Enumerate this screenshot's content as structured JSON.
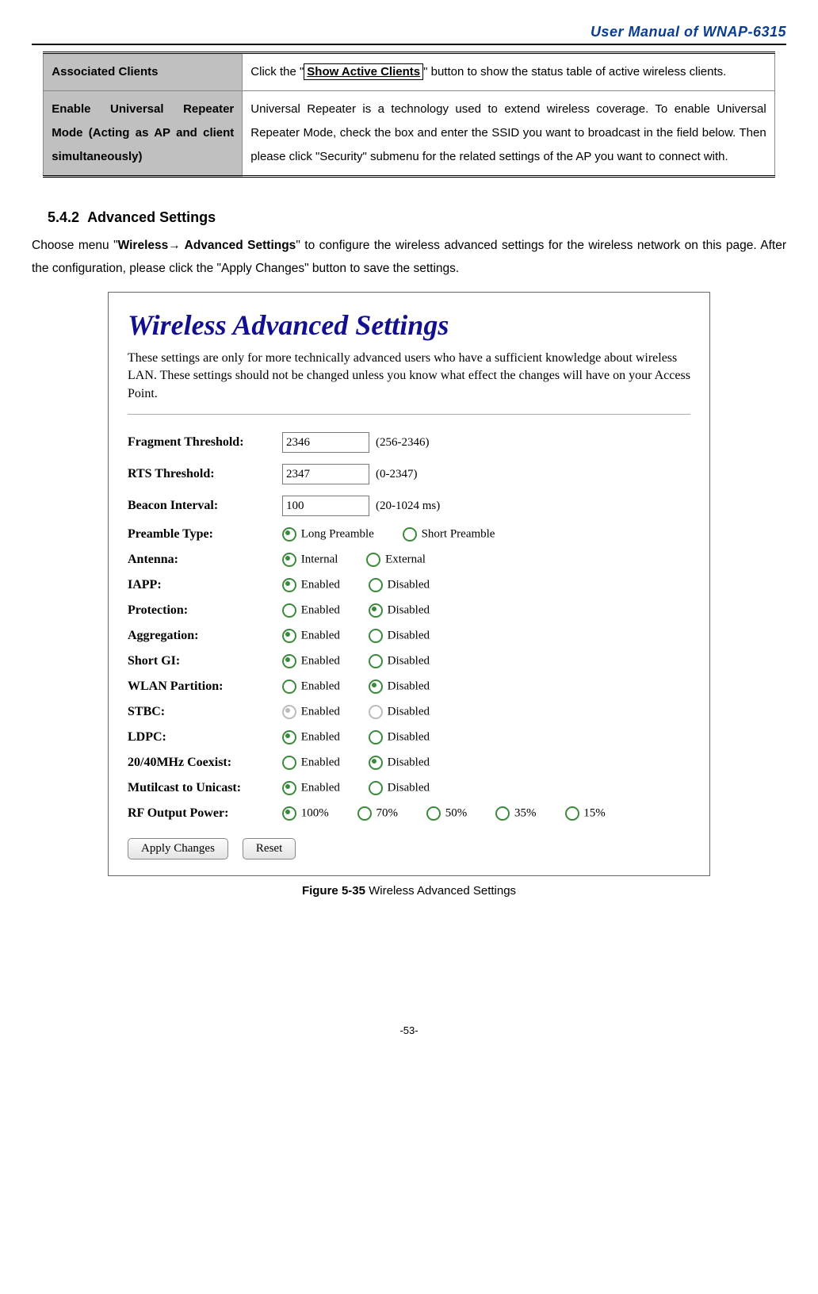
{
  "header": {
    "manual_title": "User Manual of WNAP-6315"
  },
  "table": {
    "rows": [
      {
        "label": "Associated Clients",
        "value_pre": "Click the \"",
        "button": "Show Active Clients",
        "value_post": "\" button to show the status table of active wireless clients."
      },
      {
        "label": "Enable Universal Repeater Mode (Acting as AP and client simultaneously)",
        "value": "Universal Repeater is a technology used to extend wireless coverage. To enable Universal Repeater Mode, check the box and enter the SSID you want to broadcast in the field below. Then please click \"Security\" submenu for the related settings of the AP you want to connect with."
      }
    ]
  },
  "section": {
    "number": "5.4.2",
    "title": "Advanced Settings",
    "paragraph_parts": {
      "pre": "Choose menu \"",
      "bold": "Wireless→ Advanced Settings",
      "post": "\" to configure the wireless advanced settings for the wireless network on this page. After the configuration, please click the \"Apply Changes\" button to save the settings."
    }
  },
  "figure": {
    "title": "Wireless Advanced Settings",
    "intro": "These settings are only for more technically advanced users who have a sufficient knowledge about wireless LAN. These settings should not be changed unless you know what effect the changes will have on your Access Point.",
    "settings": [
      {
        "label": "Fragment Threshold:",
        "type": "text",
        "value": "2346",
        "hint": "(256-2346)"
      },
      {
        "label": "RTS Threshold:",
        "type": "text",
        "value": "2347",
        "hint": "(0-2347)"
      },
      {
        "label": "Beacon Interval:",
        "type": "text",
        "value": "100",
        "hint": "(20-1024 ms)"
      },
      {
        "label": "Preamble Type:",
        "type": "radio",
        "options": [
          "Long Preamble",
          "Short Preamble"
        ],
        "selected": 0
      },
      {
        "label": "Antenna:",
        "type": "radio",
        "options": [
          "Internal",
          "External"
        ],
        "selected": 0
      },
      {
        "label": "IAPP:",
        "type": "radio",
        "options": [
          "Enabled",
          "Disabled"
        ],
        "selected": 0
      },
      {
        "label": "Protection:",
        "type": "radio",
        "options": [
          "Enabled",
          "Disabled"
        ],
        "selected": 1
      },
      {
        "label": "Aggregation:",
        "type": "radio",
        "options": [
          "Enabled",
          "Disabled"
        ],
        "selected": 0
      },
      {
        "label": "Short GI:",
        "type": "radio",
        "options": [
          "Enabled",
          "Disabled"
        ],
        "selected": 0
      },
      {
        "label": "WLAN Partition:",
        "type": "radio",
        "options": [
          "Enabled",
          "Disabled"
        ],
        "selected": 1
      },
      {
        "label": "STBC:",
        "type": "radio",
        "options": [
          "Enabled",
          "Disabled"
        ],
        "selected": 0,
        "dim": true
      },
      {
        "label": "LDPC:",
        "type": "radio",
        "options": [
          "Enabled",
          "Disabled"
        ],
        "selected": 0
      },
      {
        "label": "20/40MHz Coexist:",
        "type": "radio",
        "options": [
          "Enabled",
          "Disabled"
        ],
        "selected": 1
      },
      {
        "label": "Mutilcast to Unicast:",
        "type": "radio",
        "options": [
          "Enabled",
          "Disabled"
        ],
        "selected": 0
      },
      {
        "label": "RF Output Power:",
        "type": "radio",
        "options": [
          "100%",
          "70%",
          "50%",
          "35%",
          "15%"
        ],
        "selected": 0
      }
    ],
    "buttons": {
      "apply": "Apply Changes",
      "reset": "Reset"
    },
    "caption_bold": "Figure 5-35",
    "caption_rest": " Wireless Advanced Settings"
  },
  "page_number": "-53-"
}
